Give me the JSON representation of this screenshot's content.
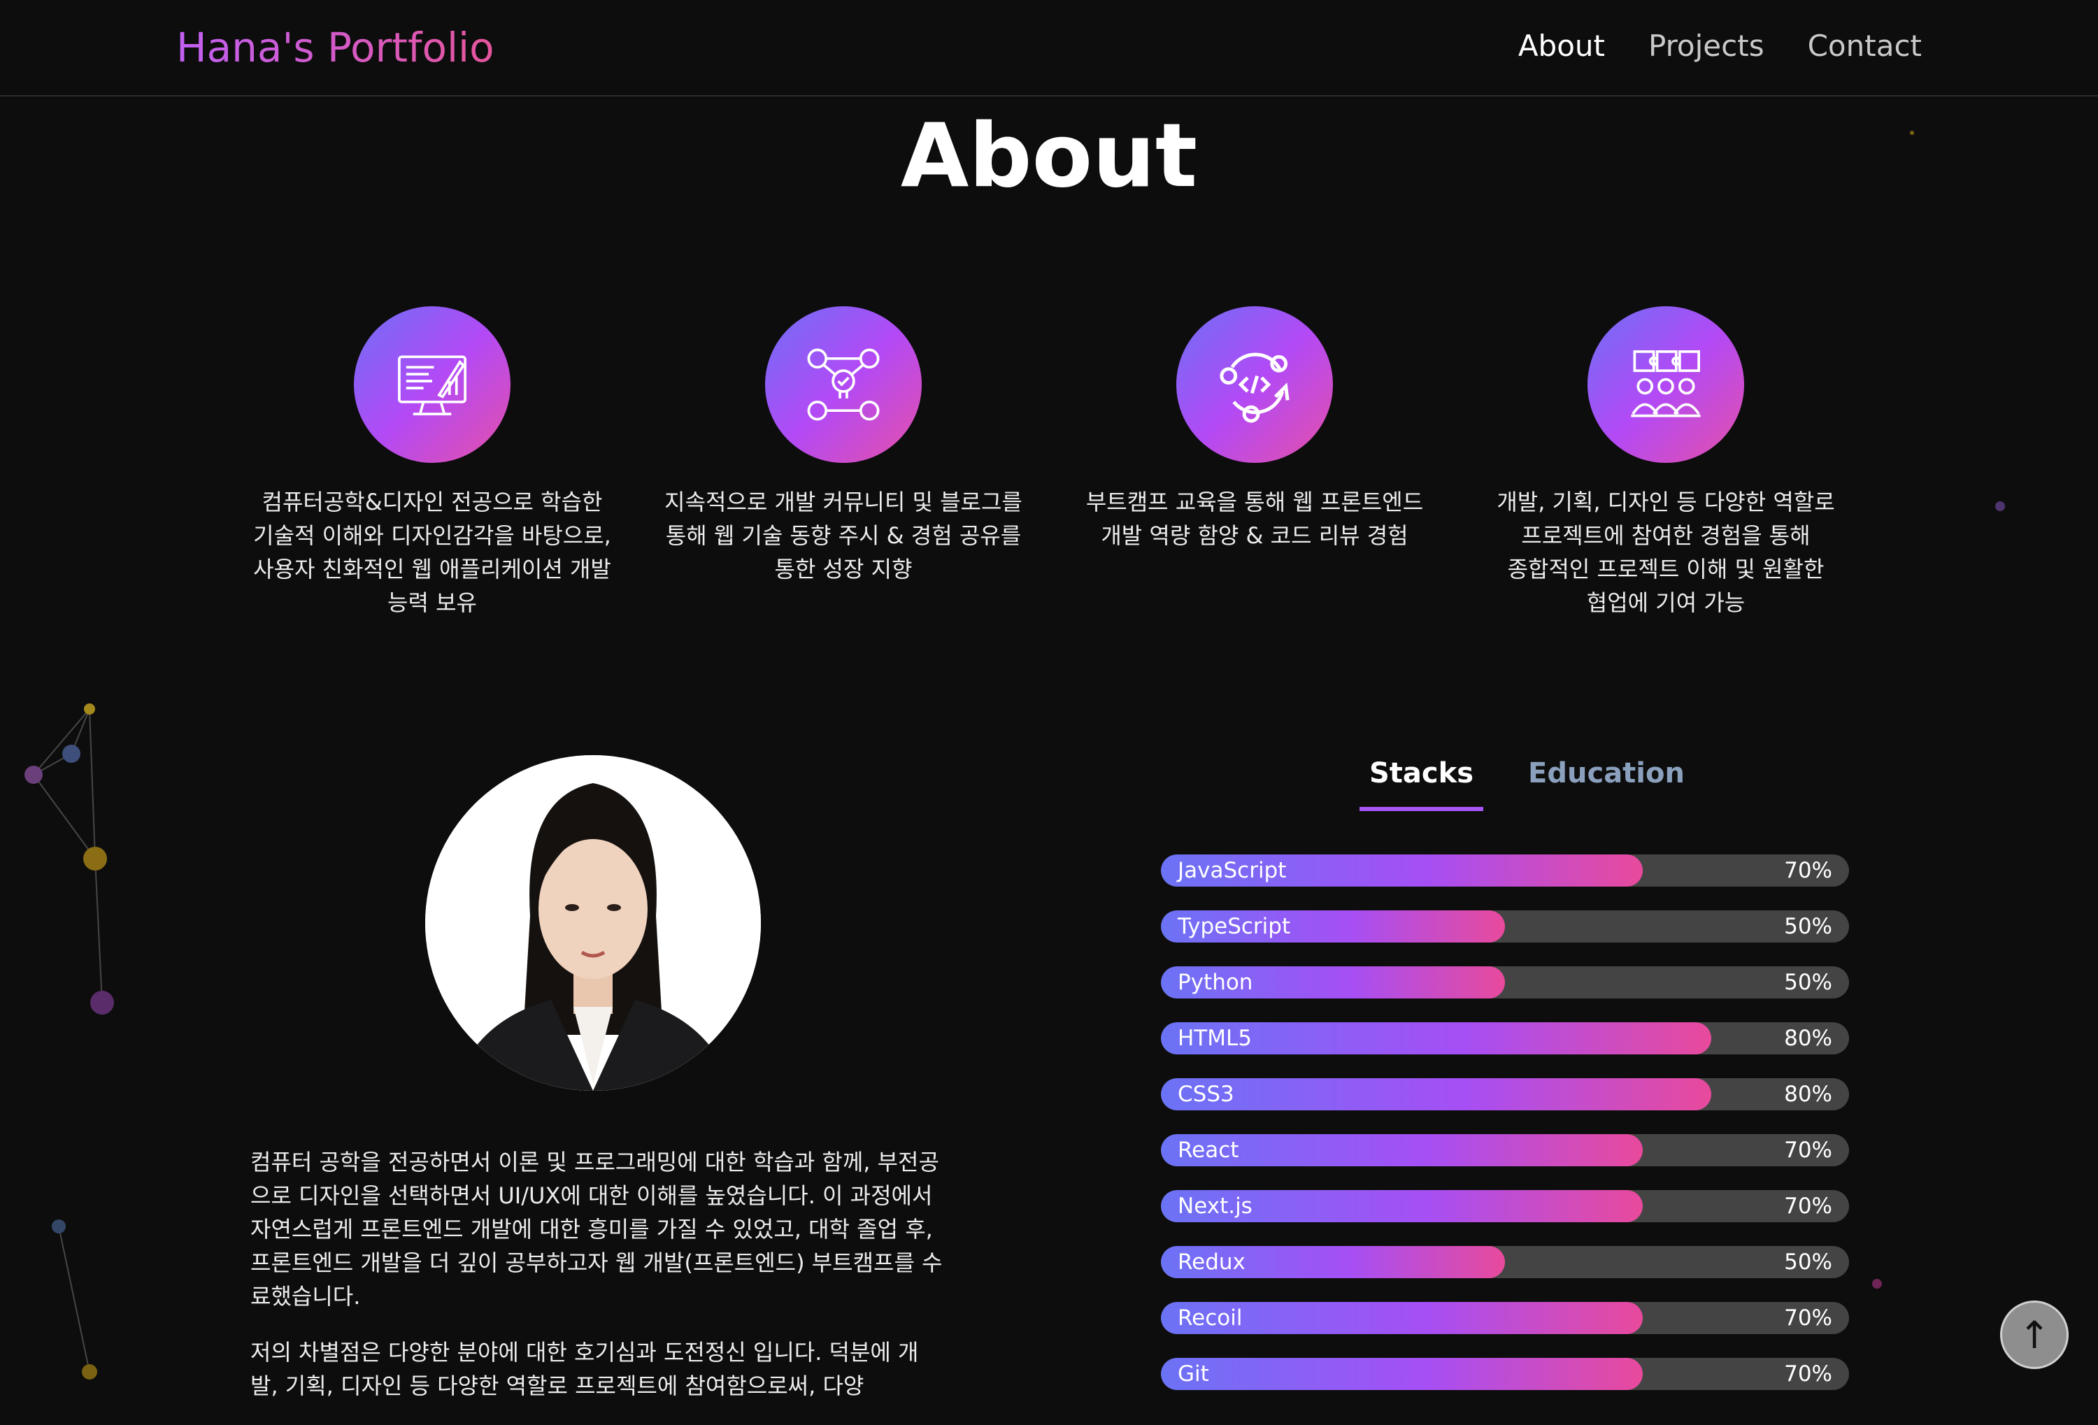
{
  "header": {
    "logo": "Hana's Portfolio",
    "nav": [
      {
        "label": "About",
        "active": true
      },
      {
        "label": "Projects",
        "active": false
      },
      {
        "label": "Contact",
        "active": false
      }
    ]
  },
  "page_title": "About",
  "features": [
    {
      "icon": "monitor-design-icon",
      "text": "컴퓨터공학&디자인 전공으로 학습한 기술적 이해와 디자인감각을 바탕으로, 사용자 친화적인 웹 애플리케이션 개발 능력 보유"
    },
    {
      "icon": "community-network-icon",
      "text": "지속적으로 개발 커뮤니티 및 블로그를 통해 웹 기술 동향 주시 & 경험 공유를 통한 성장 지향"
    },
    {
      "icon": "code-review-cycle-icon",
      "text": "부트캠프 교육을 통해 웹 프론트엔드 개발 역량 함양 & 코드 리뷰 경험"
    },
    {
      "icon": "team-puzzle-icon",
      "text": "개발, 기획, 디자인 등 다양한 역할로 프로젝트에 참여한 경험을 통해 종합적인 프로젝트 이해 및 원활한 협업에 기여 가능"
    }
  ],
  "bio": [
    "컴퓨터 공학을 전공하면서 이론 및 프로그래밍에 대한 학습과 함께, 부전공으로 디자인을 선택하면서 UI/UX에 대한 이해를 높였습니다. 이 과정에서 자연스럽게 프론트엔드 개발에 대한 흥미를 가질 수 있었고, 대학 졸업 후, 프론트엔드 개발을 더 깊이 공부하고자 웹 개발(프론트엔드) 부트캠프를 수료했습니다.",
    "저의 차별점은 다양한 분야에 대한 호기심과 도전정신 입니다. 덕분에 개발, 기획, 디자인 등 다양한 역할로 프로젝트에 참여함으로써, 다양"
  ],
  "tabs": [
    {
      "label": "Stacks",
      "active": true
    },
    {
      "label": "Education",
      "active": false
    }
  ],
  "skills": [
    {
      "name": "JavaScript",
      "percent": 70,
      "label": "70%"
    },
    {
      "name": "TypeScript",
      "percent": 50,
      "label": "50%"
    },
    {
      "name": "Python",
      "percent": 50,
      "label": "50%"
    },
    {
      "name": "HTML5",
      "percent": 80,
      "label": "80%"
    },
    {
      "name": "CSS3",
      "percent": 80,
      "label": "80%"
    },
    {
      "name": "React",
      "percent": 70,
      "label": "70%"
    },
    {
      "name": "Next.js",
      "percent": 70,
      "label": "70%"
    },
    {
      "name": "Redux",
      "percent": 50,
      "label": "50%"
    },
    {
      "name": "Recoil",
      "percent": 70,
      "label": "70%"
    },
    {
      "name": "Git",
      "percent": 70,
      "label": "70%"
    }
  ],
  "scroll_top_icon": "arrow-up-icon",
  "colors": {
    "accent_start": "#6b73f5",
    "accent_mid": "#a64ff5",
    "accent_end": "#e84a9c",
    "background": "#0d0d0d"
  }
}
